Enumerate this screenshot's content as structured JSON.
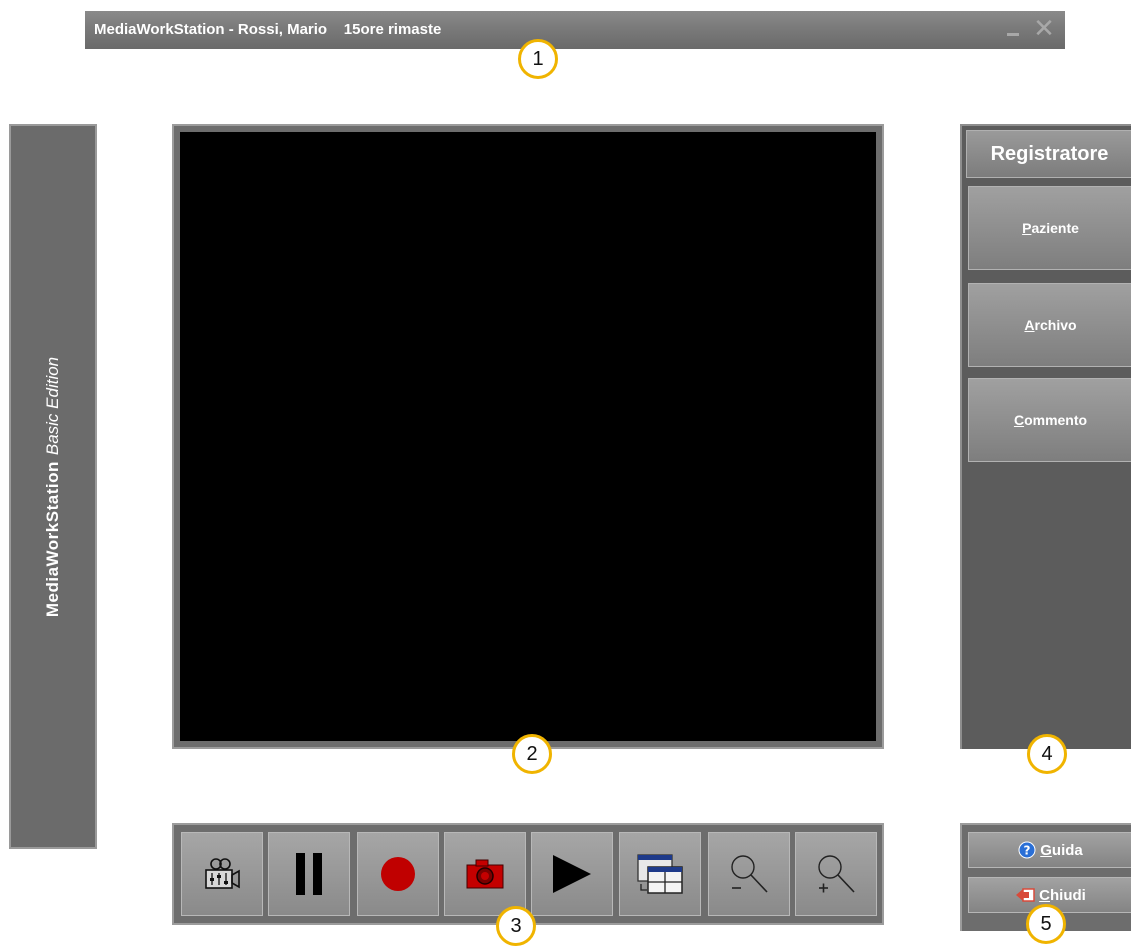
{
  "titlebar": {
    "title": "MediaWorkStation - Rossi, Mario    15ore rimaste",
    "minimize_icon": "minimize-icon",
    "close_icon": "close-icon"
  },
  "brand": {
    "name": "MediaWorkStation",
    "edition": "Basic Edition"
  },
  "right_panel": {
    "header": "Registratore",
    "buttons": [
      {
        "accel": "P",
        "rest": "aziente"
      },
      {
        "accel": "A",
        "rest": "rchivo"
      },
      {
        "accel": "C",
        "rest": "ommento"
      }
    ]
  },
  "toolbar": {
    "tools": [
      {
        "name": "camera-settings",
        "icon": "video-camera-settings-icon"
      },
      {
        "name": "pause",
        "icon": "pause-icon"
      },
      {
        "name": "record",
        "icon": "record-icon"
      },
      {
        "name": "snapshot",
        "icon": "photo-camera-icon"
      },
      {
        "name": "play",
        "icon": "play-icon"
      },
      {
        "name": "layout",
        "icon": "window-layout-icon"
      },
      {
        "name": "zoom-out",
        "icon": "zoom-out-icon"
      },
      {
        "name": "zoom-in",
        "icon": "zoom-in-icon"
      }
    ]
  },
  "mini_panel": {
    "guida": {
      "accel": "G",
      "rest": "uida",
      "icon": "help-icon"
    },
    "chiudi": {
      "accel": "C",
      "rest": "hiudi",
      "icon": "exit-arrow-icon"
    }
  },
  "callouts": [
    "1",
    "2",
    "3",
    "4",
    "5"
  ],
  "colors": {
    "accent_callout": "#f0b400",
    "record_red": "#c00000",
    "help_blue": "#2a6fd6",
    "exit_red": "#d84a3a"
  }
}
